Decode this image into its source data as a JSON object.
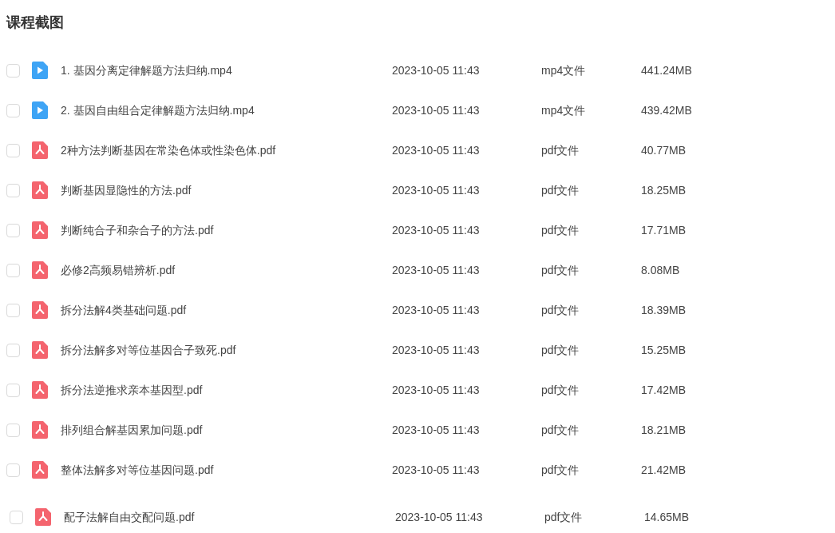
{
  "title": "课程截图",
  "files": [
    {
      "kind": "video",
      "checked": false,
      "name": "1. 基因分离定律解题方法归纳.mp4",
      "date": "2023-10-05 11:43",
      "type": "mp4文件",
      "size": "441.24MB"
    },
    {
      "kind": "video",
      "checked": false,
      "name": "2. 基因自由组合定律解题方法归纳.mp4",
      "date": "2023-10-05 11:43",
      "type": "mp4文件",
      "size": "439.42MB"
    },
    {
      "kind": "pdf",
      "checked": false,
      "name": "2种方法判断基因在常染色体或性染色体.pdf",
      "date": "2023-10-05 11:43",
      "type": "pdf文件",
      "size": "40.77MB"
    },
    {
      "kind": "pdf",
      "checked": false,
      "name": "判断基因显隐性的方法.pdf",
      "date": "2023-10-05 11:43",
      "type": "pdf文件",
      "size": "18.25MB"
    },
    {
      "kind": "pdf",
      "checked": false,
      "name": "判断纯合子和杂合子的方法.pdf",
      "date": "2023-10-05 11:43",
      "type": "pdf文件",
      "size": "17.71MB"
    },
    {
      "kind": "pdf",
      "checked": false,
      "name": "必修2高频易错辨析.pdf",
      "date": "2023-10-05 11:43",
      "type": "pdf文件",
      "size": "8.08MB"
    },
    {
      "kind": "pdf",
      "checked": false,
      "name": "拆分法解4类基础问题.pdf",
      "date": "2023-10-05 11:43",
      "type": "pdf文件",
      "size": "18.39MB"
    },
    {
      "kind": "pdf",
      "checked": false,
      "name": "拆分法解多对等位基因合子致死.pdf",
      "date": "2023-10-05 11:43",
      "type": "pdf文件",
      "size": "15.25MB"
    },
    {
      "kind": "pdf",
      "checked": false,
      "name": "拆分法逆推求亲本基因型.pdf",
      "date": "2023-10-05 11:43",
      "type": "pdf文件",
      "size": "17.42MB"
    },
    {
      "kind": "pdf",
      "checked": false,
      "name": "排列组合解基因累加问题.pdf",
      "date": "2023-10-05 11:43",
      "type": "pdf文件",
      "size": "18.21MB"
    },
    {
      "kind": "pdf",
      "checked": false,
      "name": "整体法解多对等位基因问题.pdf",
      "date": "2023-10-05 11:43",
      "type": "pdf文件",
      "size": "21.42MB"
    },
    {
      "kind": "pdf",
      "checked": false,
      "name": "配子法解自由交配问题.pdf",
      "date": "2023-10-05 11:43",
      "type": "pdf文件",
      "size": "14.65MB"
    }
  ]
}
